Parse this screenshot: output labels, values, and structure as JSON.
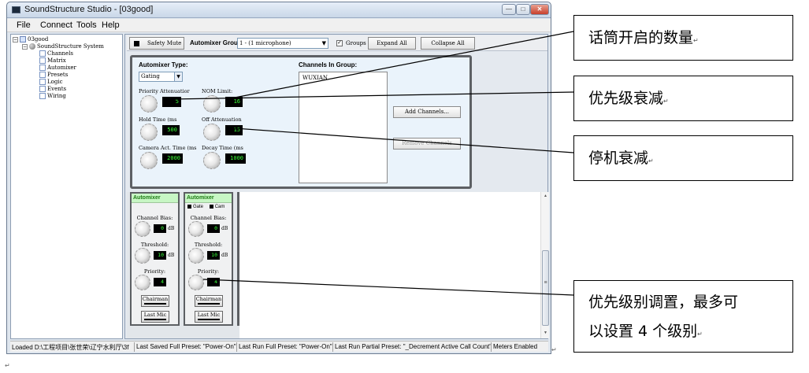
{
  "window": {
    "title": "SoundStructure Studio - [03good]",
    "min_glyph": "—",
    "max_glyph": "□",
    "close_glyph": "✕"
  },
  "menu": [
    "File",
    "Connect",
    "Tools",
    "Help"
  ],
  "tree": {
    "root": "03good",
    "system": "SoundStructure System",
    "items": [
      "Channels",
      "Matrix",
      "Automixer",
      "Presets",
      "Logic",
      "Events",
      "Wiring"
    ]
  },
  "toolbar": {
    "safety_mute": "Safety Mute",
    "automixer_group_label": "Automixer Group:",
    "automixer_group_value": "1 - (1 microphone)",
    "groups_checked": "✓",
    "groups_label": "Groups",
    "expand_all": "Expand All",
    "collapse_all": "Collapse All"
  },
  "settings": {
    "automixer_type_label": "Automixer Type:",
    "automixer_type_value": "Gating",
    "priority_attenuation_label": "Priority Attenuatior",
    "priority_attenuation_value": "5",
    "nom_limit_label": "NOM Limit:",
    "nom_limit_value": "16",
    "hold_time_label": "Hold Time (ms",
    "hold_time_value": "500",
    "off_attenuation_label": "Off Attenuation",
    "off_attenuation_value": "15",
    "camera_act_time_label": "Camera Act. Time (ms",
    "camera_act_time_value": "2000",
    "decay_time_label": "Decay Time (ms",
    "decay_time_value": "1000",
    "channels_in_group_label": "Channels In Group:",
    "channels_in_group_items": [
      "WUXIAN"
    ],
    "add_channels": "Add Channels...",
    "remove_channels": "Remove Channels"
  },
  "strips": [
    {
      "header": "Automixer",
      "channel_bias_label": "Channel Bias:",
      "channel_bias_value": "0",
      "threshold_label": "Threshold:",
      "threshold_value": "10",
      "priority_label": "Priority:",
      "priority_value": "4",
      "unit": "dB",
      "chairman": "Chairman",
      "last_mic": "Last Mic"
    },
    {
      "header": "Automixer",
      "gate_label": "Gate",
      "cam_label": "Cam",
      "channel_bias_label": "Channel Bias:",
      "channel_bias_value": "0",
      "threshold_label": "Threshold:",
      "threshold_value": "10",
      "priority_label": "Priority:",
      "priority_value": "4",
      "unit": "dB",
      "chairman": "Chairman",
      "last_mic": "Last Mic"
    }
  ],
  "scrollbar": {
    "up": "▲",
    "down": "▼",
    "grip": "≡"
  },
  "statusbar": [
    "Loaded D:\\工程项目\\张世荣\\辽宁水利厅\\3f",
    "Last Saved Full Preset: \"Power-On\"",
    "Last Run Full Preset: \"Power-On\"",
    "Last Run Partial Preset: \"_Decrement Active Call Count\"",
    "Meters Enabled"
  ],
  "callouts": [
    {
      "text": "话筒开启的数量",
      "mark": "↵"
    },
    {
      "text": "优先级衰减",
      "mark": "↵"
    },
    {
      "text": "停机衰减",
      "mark": "↵"
    },
    {
      "line1": "优先级别调置，最多可",
      "line2": "以设置 4 个级别",
      "mark": "↵"
    }
  ],
  "marks": {
    "after_window": "↵",
    "bottom_left": "↵"
  }
}
